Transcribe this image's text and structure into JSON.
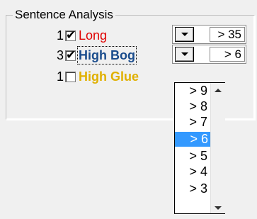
{
  "group": {
    "title": "Sentence Analysis"
  },
  "rows": [
    {
      "number": "1",
      "checked": true,
      "label": "Long",
      "value": "> 35"
    },
    {
      "number": "3",
      "checked": true,
      "label": "High Bog",
      "value": "> 6"
    },
    {
      "number": "1",
      "checked": false,
      "label": "High Glue"
    }
  ],
  "dropdown": {
    "options": [
      "> 9",
      "> 8",
      "> 7",
      "> 6",
      "> 5",
      "> 4",
      "> 3"
    ],
    "selected_index": 3
  },
  "icons": {
    "checkbox_tick": "check-icon",
    "dropdown_arrow": "chevron-down-icon",
    "scroll_up": "scroll-up-arrow-icon",
    "scroll_down": "scroll-down-arrow-icon"
  },
  "colors": {
    "long_label": "#e00000",
    "bog_label": "#1a4c8c",
    "glue_label": "#e0b000",
    "selection": "#3399ff"
  }
}
